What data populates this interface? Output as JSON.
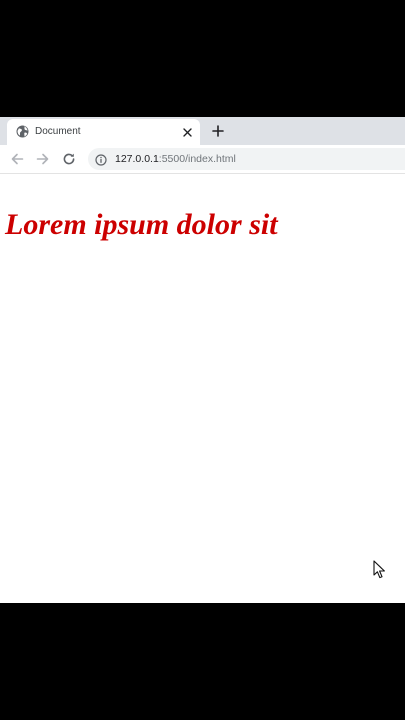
{
  "tab": {
    "title": "Document",
    "favicon_icon": "globe-icon",
    "close_icon": "close-icon"
  },
  "toolbar": {
    "new_tab_icon": "plus-icon",
    "back_icon": "arrow-left-icon",
    "forward_icon": "arrow-right-icon",
    "reload_icon": "reload-icon",
    "info_icon": "info-icon"
  },
  "address_bar": {
    "host": "127.0.0.1",
    "path": ":5500/index.html"
  },
  "page": {
    "heading": "Lorem ipsum dolor sit",
    "heading_color": "#cc0000"
  },
  "colors": {
    "tab_strip": "#dee1e6",
    "omnibox": "#f1f3f4"
  }
}
